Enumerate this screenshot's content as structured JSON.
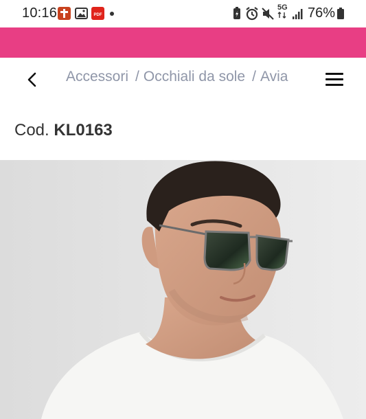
{
  "status": {
    "time": "10:16",
    "network": "5G",
    "battery": "76%"
  },
  "nav": {
    "breadcrumbs": [
      "Accessori",
      "Occhiali da sole",
      "Avia"
    ],
    "separator": "/"
  },
  "product": {
    "code_label": "Cod.",
    "code_value": "KL0163"
  },
  "colors": {
    "accent": "#e83e84",
    "breadcrumb": "#8f96a8"
  }
}
